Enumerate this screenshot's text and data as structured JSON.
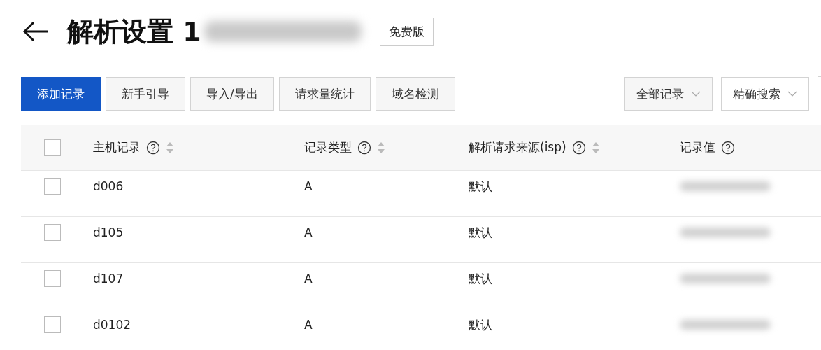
{
  "header": {
    "title": "解析设置 1",
    "badge": "免费版"
  },
  "toolbar": {
    "buttons": [
      {
        "label": "添加记录",
        "kind": "primary"
      },
      {
        "label": "新手引导",
        "kind": "default"
      },
      {
        "label": "导入/导出",
        "kind": "default"
      },
      {
        "label": "请求量统计",
        "kind": "default"
      },
      {
        "label": "域名检测",
        "kind": "default"
      }
    ],
    "filters": [
      {
        "label": "全部记录",
        "kind": "shaded"
      },
      {
        "label": "精确搜索",
        "kind": "plain"
      }
    ]
  },
  "table": {
    "header_checkbox": {
      "checked": false
    },
    "columns": [
      {
        "label": "主机记录",
        "help": true,
        "sortable": true
      },
      {
        "label": "记录类型",
        "help": true,
        "sortable": true
      },
      {
        "label": "解析请求来源(isp)",
        "help": true,
        "sortable": true
      },
      {
        "label": "记录值",
        "help": true,
        "sortable": false
      }
    ],
    "rows": [
      {
        "checked": false,
        "host": "d006",
        "type": "A",
        "isp": "默认",
        "value_blurred": true
      },
      {
        "checked": false,
        "host": "d105",
        "type": "A",
        "isp": "默认",
        "value_blurred": true
      },
      {
        "checked": false,
        "host": "d107",
        "type": "A",
        "isp": "默认",
        "value_blurred": true
      },
      {
        "checked": false,
        "host": "d0102",
        "type": "A",
        "isp": "默认",
        "value_blurred": true
      }
    ]
  }
}
